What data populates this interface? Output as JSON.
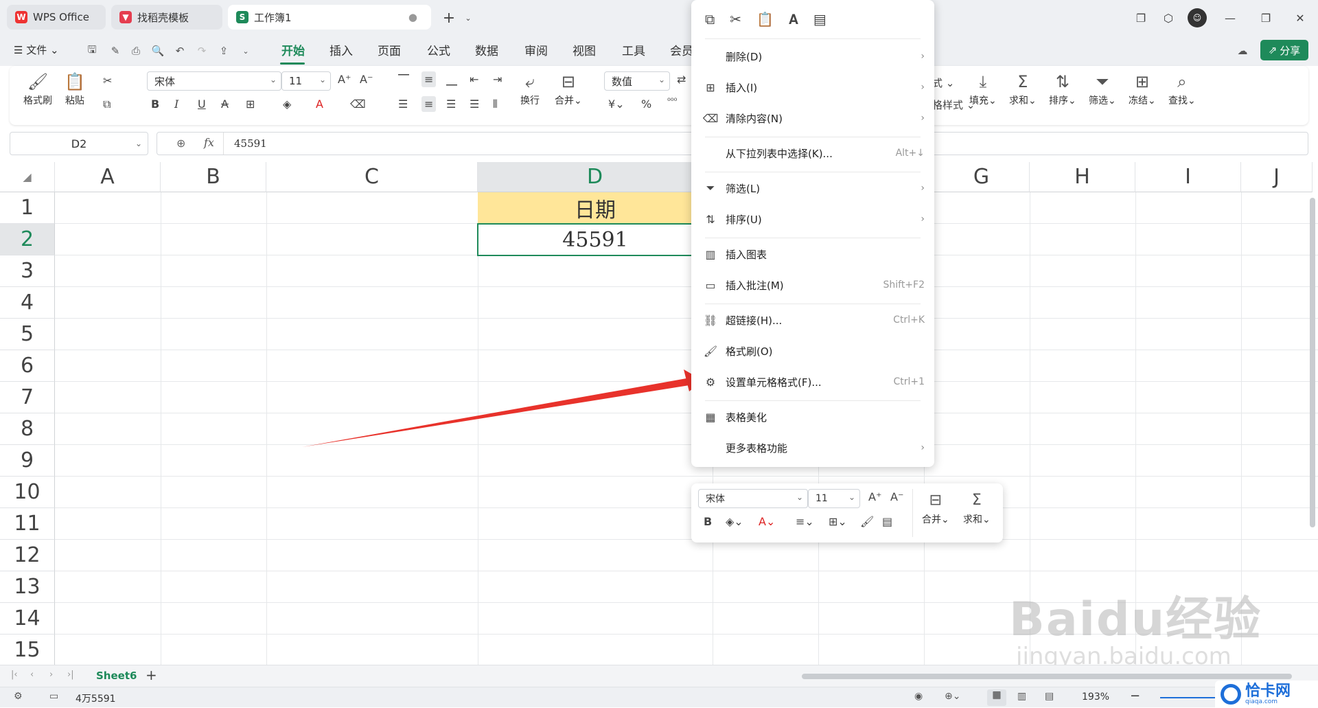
{
  "tabs": [
    {
      "label": "WPS Office"
    },
    {
      "label": "找稻壳模板"
    },
    {
      "label": "工作簿1"
    }
  ],
  "menu": {
    "file": "文件",
    "items": [
      "开始",
      "插入",
      "页面",
      "公式",
      "数据",
      "审阅",
      "视图",
      "工具",
      "会员"
    ],
    "active": "开始",
    "share": "分享"
  },
  "ribbon": {
    "format_painter": "格式刷",
    "paste": "粘贴",
    "font": "宋体",
    "font_size": "11",
    "wrap": "换行",
    "merge": "合并",
    "number_format": "数值",
    "currency": "¥",
    "percent": "%",
    "partial_1": "式",
    "partial_2": "格样式",
    "fill": "填充",
    "sum": "求和",
    "sort": "排序",
    "filter": "筛选",
    "freeze": "冻结",
    "find": "查找"
  },
  "formula_bar": {
    "cell_ref": "D2",
    "fx": "fx",
    "value": "45591"
  },
  "grid": {
    "columns": [
      "A",
      "B",
      "C",
      "D",
      "G",
      "H",
      "I",
      "J"
    ],
    "rows": [
      "1",
      "2",
      "3",
      "4",
      "5",
      "6",
      "7",
      "8",
      "9",
      "10",
      "11",
      "12",
      "13",
      "14",
      "15"
    ],
    "d1": "日期",
    "d2": "45591"
  },
  "context_menu": {
    "items": [
      {
        "label": "删除(D)",
        "shortcut": "",
        "arrow": true
      },
      {
        "label": "插入(I)",
        "shortcut": "",
        "arrow": true
      },
      {
        "label": "清除内容(N)",
        "shortcut": "",
        "arrow": true
      },
      {
        "label": "从下拉列表中选择(K)...",
        "shortcut": "Alt+↓",
        "arrow": false
      },
      {
        "label": "筛选(L)",
        "shortcut": "",
        "arrow": true
      },
      {
        "label": "排序(U)",
        "shortcut": "",
        "arrow": true
      },
      {
        "label": "插入图表",
        "shortcut": "",
        "arrow": false
      },
      {
        "label": "插入批注(M)",
        "shortcut": "Shift+F2",
        "arrow": false
      },
      {
        "label": "超链接(H)...",
        "shortcut": "Ctrl+K",
        "arrow": false
      },
      {
        "label": "格式刷(O)",
        "shortcut": "",
        "arrow": false
      },
      {
        "label": "设置单元格格式(F)...",
        "shortcut": "Ctrl+1",
        "arrow": false
      },
      {
        "label": "表格美化",
        "shortcut": "",
        "arrow": false
      },
      {
        "label": "更多表格功能",
        "shortcut": "",
        "arrow": true
      }
    ]
  },
  "mini_toolbar": {
    "font": "宋体",
    "size": "11",
    "merge": "合并",
    "sum": "求和"
  },
  "sheet": {
    "name": "Sheet6"
  },
  "status": {
    "value": "4万5591",
    "zoom": "193%"
  },
  "watermark": {
    "brand": "Baidu经验",
    "url": "jingyan.baidu.com",
    "corner": "恰卡网",
    "corner_url": "qiaqa.com"
  },
  "colors": {
    "accent": "#1e8a5a",
    "header_fill": "#ffe699",
    "arrow": "#e8322b"
  }
}
